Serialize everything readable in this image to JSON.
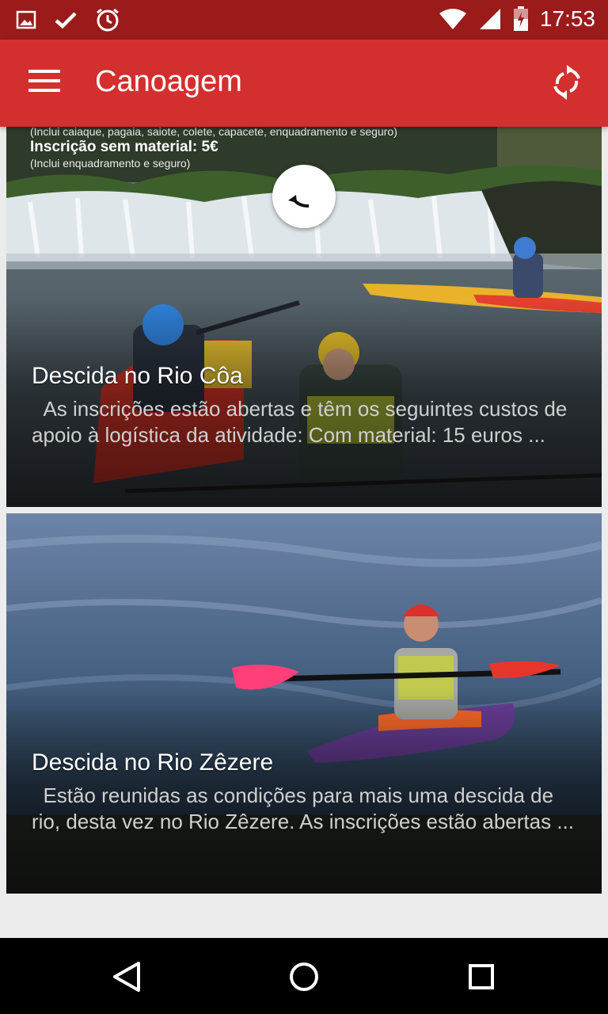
{
  "status_bar": {
    "time": "17:53",
    "left_icons": [
      "image-icon",
      "check-icon",
      "alarm-icon"
    ],
    "right_icons": [
      "wifi-icon",
      "signal-icon",
      "battery-charging-icon"
    ]
  },
  "app_bar": {
    "title": "Canoagem",
    "menu_icon": "hamburger-menu-icon",
    "action_icon": "refresh-icon",
    "color": "#d32f2f",
    "status_color": "#9b1a1a"
  },
  "cards": [
    {
      "poster_text": [
        "(Inclui caiaque, pagaia, saiote, colete, capacete, enquadramento e seguro)",
        "Inscrição sem material: 5€",
        "(Inclui enquadramento e seguro)"
      ],
      "title": "Descida no Rio Côa",
      "excerpt": "  As inscrições estão abertas e têm os seguintes custos de apoio à logística da atividade: Com material: 15 euros ..."
    },
    {
      "title": "Descida no Rio Zêzere",
      "excerpt": "  Estão reunidas as condições para mais uma descida de rio, desta vez no Rio Zêzere. As inscrições estão abertas ..."
    }
  ],
  "nav_bar": {
    "buttons": [
      "back-icon",
      "home-icon",
      "recents-icon"
    ]
  }
}
